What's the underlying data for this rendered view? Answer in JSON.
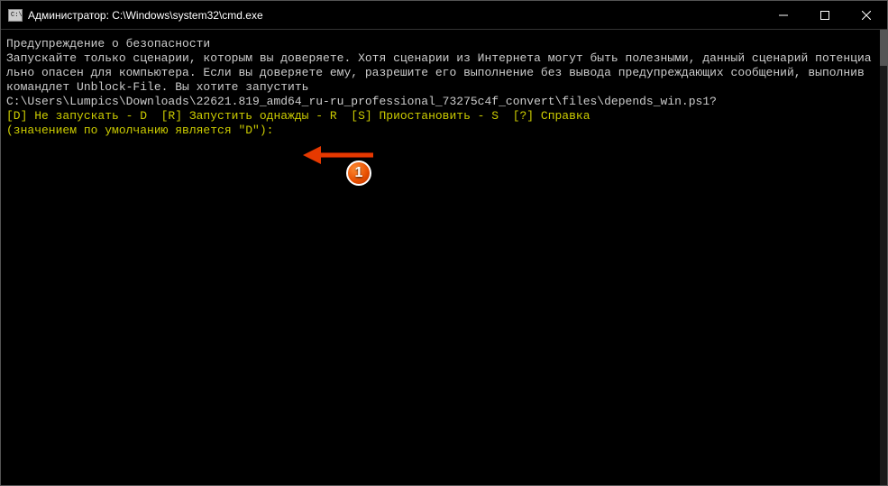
{
  "window": {
    "title": "Администратор: C:\\Windows\\system32\\cmd.exe"
  },
  "terminal": {
    "lines": [
      {
        "cls": "white",
        "text": "Предупреждение о безопасности"
      },
      {
        "cls": "white",
        "text": "Запускайте только сценарии, которым вы доверяете. Хотя сценарии из Интернета могут быть полезными, данный сценарий потенциально опасен для компьютера. Если вы доверяете ему, разрешите его выполнение без вывода предупреждающих сообщений, выполнив командлет Unblock-File. Вы хотите запустить"
      },
      {
        "cls": "white",
        "text": "C:\\Users\\Lumpics\\Downloads\\22621.819_amd64_ru-ru_professional_73275c4f_convert\\files\\depends_win.ps1?"
      },
      {
        "cls": "yellow",
        "text": "[D] Не запускать - D  [R] Запустить однажды - R  [S] Приостановить - S  [?] Справка"
      },
      {
        "cls": "yellow",
        "text": "(значением по умолчанию является \"D\"):"
      }
    ]
  },
  "annotation": {
    "badge": "1"
  }
}
